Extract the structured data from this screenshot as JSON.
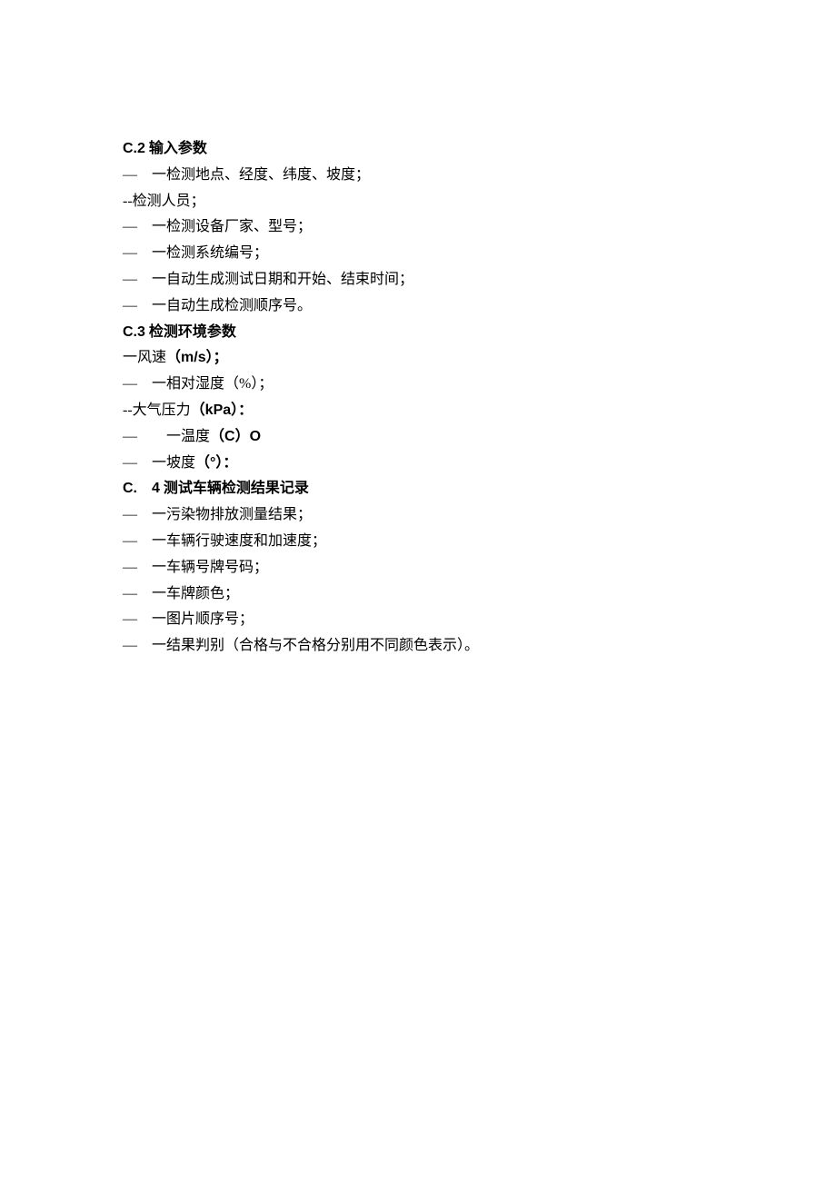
{
  "sections": [
    {
      "heading_label": "C.2",
      "heading_text": "输入参数",
      "items": [
        {
          "prefix": "—　一",
          "text": "检测地点、经度、纬度、坡度；"
        },
        {
          "prefix": " --",
          "text": "检测人员；"
        },
        {
          "prefix": "—　一",
          "text": "检测设备厂家、型号；"
        },
        {
          "prefix": "—　一",
          "text": "检测系统编号；"
        },
        {
          "prefix": "—　一",
          "text": "自动生成测试日期和开始、结束时间；"
        },
        {
          "prefix": "—　一",
          "text": "自动生成检测顺序号。"
        }
      ]
    },
    {
      "heading_label": "C.3",
      "heading_text": "检测环境参数",
      "items": [
        {
          "prefix": " 一",
          "text_parts": [
            "风速",
            "（m/s）；"
          ],
          "bold_idx": 1
        },
        {
          "prefix": "—　一",
          "text": "相对湿度（%）；"
        },
        {
          "prefix": " --",
          "text_parts": [
            "大气压力",
            "（kPa）："
          ],
          "bold_idx": 1
        },
        {
          "prefix": "—　　一",
          "text_parts": [
            "温度",
            "（C）O"
          ],
          "bold_idx": 1
        },
        {
          "prefix": "—　一",
          "text_parts": [
            "坡度",
            "（°）："
          ],
          "bold_idx": 1
        }
      ]
    },
    {
      "heading_label": "C.",
      "heading_num": "4",
      "heading_text": "测试车辆检测结果记录",
      "items": [
        {
          "prefix": "—　一",
          "text": "污染物排放测量结果；"
        },
        {
          "prefix": "—　一",
          "text": "车辆行驶速度和加速度；"
        },
        {
          "prefix": "—　一",
          "text": "车辆号牌号码；"
        },
        {
          "prefix": "—　一",
          "text": "车牌颜色；"
        },
        {
          "prefix": "—　一",
          "text": "图片顺序号；"
        },
        {
          "prefix": "—　一",
          "text": "结果判别（合格与不合格分别用不同颜色表示）。"
        }
      ]
    }
  ]
}
